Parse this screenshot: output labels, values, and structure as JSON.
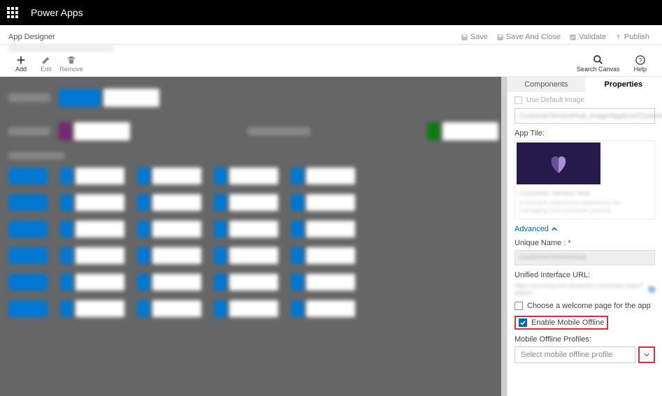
{
  "header": {
    "brand": "Power Apps"
  },
  "subheader": {
    "crumb": "App Designer",
    "actions": {
      "save": "Save",
      "save_close": "Save And Close",
      "validate": "Validate",
      "publish": "Publish"
    }
  },
  "page_title_blurred": "Customer Service Hub",
  "toolbar": {
    "add": "Add",
    "edit": "Edit",
    "remove": "Remove",
    "search": "Search Canvas",
    "help": "Help"
  },
  "panel": {
    "tabs": {
      "components": "Components",
      "properties": "Properties"
    },
    "use_default_image": "Use Default Image",
    "image_dropdown_blurred": "CustomerServiceHub_image/AppIcon/Customer...",
    "app_tile_label": "App Tile:",
    "tile_title_blurred": "Customer Service Hub",
    "tile_desc_blurred": "A focused, interactive experience for managing your customer service.",
    "advanced": "Advanced",
    "unique_name_label": "Unique Name : *",
    "unique_name_blurred": "CustomerServiceHub",
    "url_label": "Unified Interface URL:",
    "url_blurred": "https://yourorg.crm.dynamics.com/main.aspx?appid=...",
    "welcome": "Choose a welcome page for the app",
    "enable_offline": "Enable Mobile Offline",
    "profiles_label": "Mobile Offline Profiles:",
    "profiles_placeholder": "Select mobile offline profile"
  }
}
